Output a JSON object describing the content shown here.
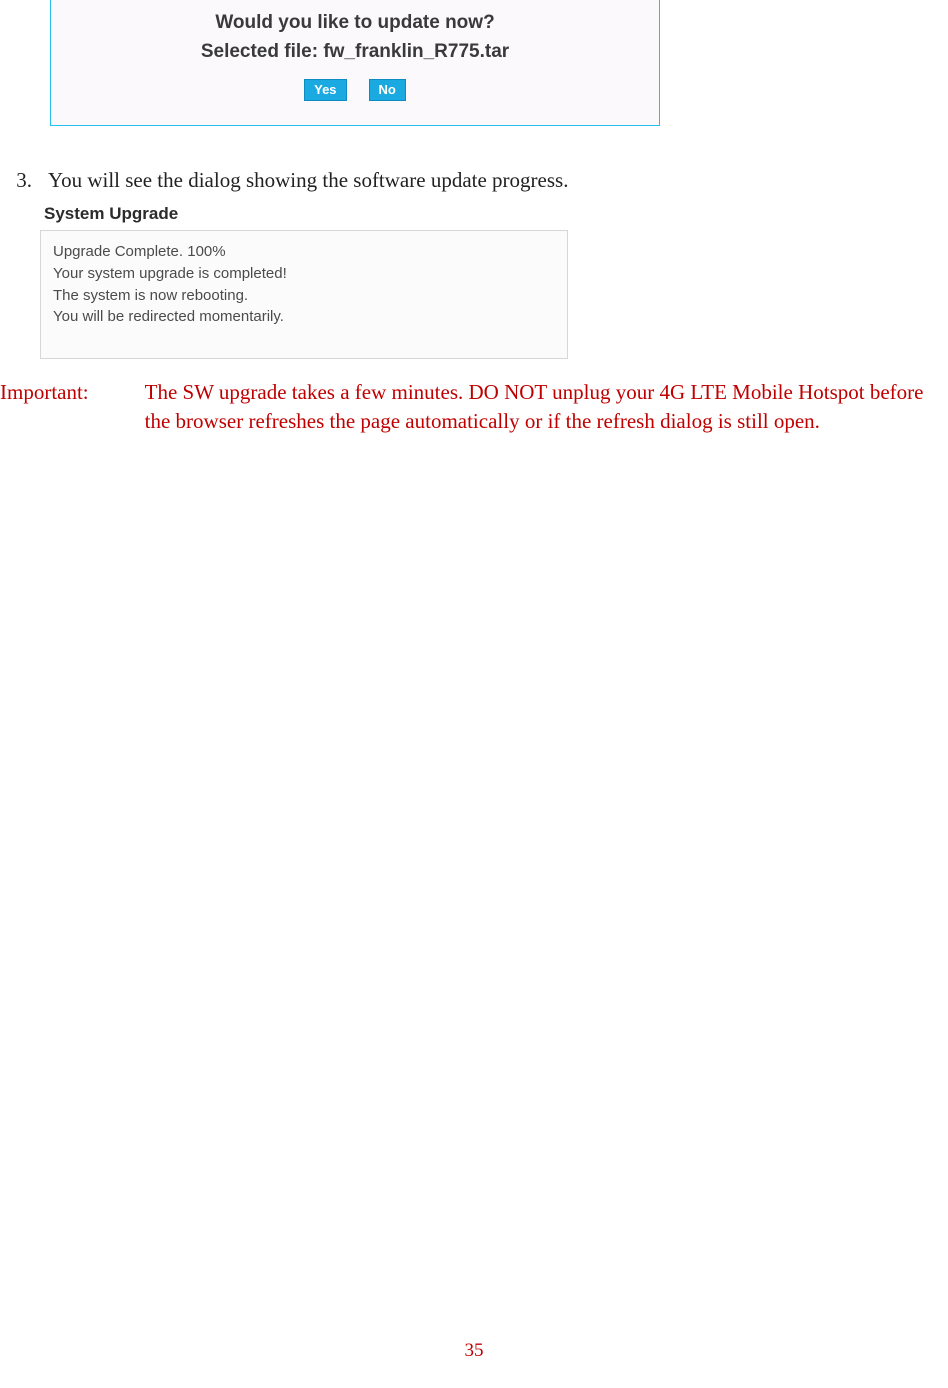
{
  "confirm": {
    "line1": "Would you like to update now?",
    "line2": "Selected file: fw_franklin_R775.tar",
    "yes": "Yes",
    "no": "No"
  },
  "step3": {
    "num": "3.",
    "text": "You will see the dialog showing the software update progress."
  },
  "sysup": {
    "title": "System Upgrade",
    "l1": "Upgrade Complete. 100%",
    "l2": "Your system upgrade is completed!",
    "l3": "The system is now rebooting.",
    "l4": "You will be redirected momentarily."
  },
  "important": {
    "label": "Important:",
    "text": "The SW upgrade takes a few minutes. DO NOT unplug your 4G LTE Mobile Hotspot before the browser refreshes the page automatically or if the refresh dialog is still open."
  },
  "page_number": "35"
}
